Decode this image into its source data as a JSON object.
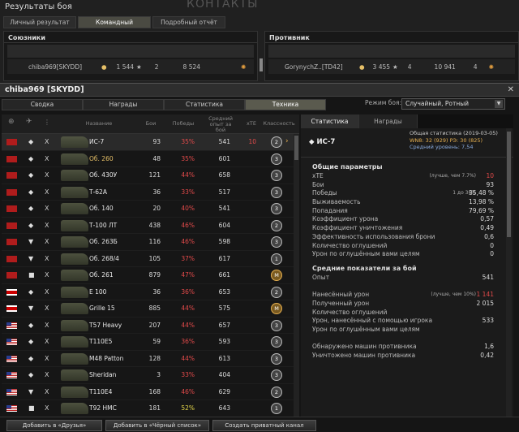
{
  "bg": {
    "faint": "КОНТАКТЫ",
    "title": "Результаты боя",
    "tabs": [
      "Личный результат",
      "Командный результат",
      "Подробный отчёт"
    ]
  },
  "allies": {
    "title": "Союзники",
    "player": "chiba969[SKYDD]",
    "v1": "1 544",
    "v2": "2",
    "v3": "8 524"
  },
  "enemies": {
    "title": "Противник",
    "player": "GorynychZ..[TD42]",
    "v1": "3 455",
    "v2": "4",
    "v3": "10 941",
    "v4": "4"
  },
  "window": {
    "title": "chiba969 [SKYDD]",
    "tabs": [
      "Сводка",
      "Награды",
      "Статистика",
      "Техника"
    ],
    "mode_label": "Режим боя:",
    "mode_value": "Случайный, Ротный"
  },
  "columns": {
    "name": "Название",
    "battles": "Бои",
    "wins": "Победы",
    "exp": "Средний опыт за бой",
    "xte": "хТЕ",
    "class": "Классность"
  },
  "vehicles": [
    {
      "name": "ИС-7",
      "flag": "ussr",
      "type": "◆",
      "tier": "X",
      "battles": "93",
      "win": "35%",
      "wc": "red",
      "exp": "541",
      "xte": "10",
      "badge": "2",
      "bt": "",
      "gold": false,
      "sel": true
    },
    {
      "name": "Об. 260",
      "flag": "ussr",
      "type": "◆",
      "tier": "X",
      "battles": "48",
      "win": "35%",
      "wc": "red",
      "exp": "601",
      "xte": "",
      "badge": "3",
      "bt": "",
      "gold": true,
      "sel": false
    },
    {
      "name": "Об. 430У",
      "flag": "ussr",
      "type": "◆",
      "tier": "X",
      "battles": "121",
      "win": "44%",
      "wc": "red",
      "exp": "658",
      "xte": "",
      "badge": "3",
      "bt": "",
      "gold": false,
      "sel": false
    },
    {
      "name": "Т-62А",
      "flag": "ussr",
      "type": "◆",
      "tier": "X",
      "battles": "36",
      "win": "33%",
      "wc": "red",
      "exp": "517",
      "xte": "",
      "badge": "3",
      "bt": "",
      "gold": false,
      "sel": false
    },
    {
      "name": "Об. 140",
      "flag": "ussr",
      "type": "◆",
      "tier": "X",
      "battles": "20",
      "win": "40%",
      "wc": "red",
      "exp": "541",
      "xte": "",
      "badge": "3",
      "bt": "",
      "gold": false,
      "sel": false
    },
    {
      "name": "Т-100 ЛТ",
      "flag": "ussr",
      "type": "◆",
      "tier": "X",
      "battles": "438",
      "win": "46%",
      "wc": "red",
      "exp": "604",
      "xte": "",
      "badge": "2",
      "bt": "",
      "gold": false,
      "sel": false
    },
    {
      "name": "Об. 263Б",
      "flag": "ussr",
      "type": "▼",
      "tier": "X",
      "battles": "116",
      "win": "46%",
      "wc": "red",
      "exp": "598",
      "xte": "",
      "badge": "3",
      "bt": "",
      "gold": false,
      "sel": false
    },
    {
      "name": "Об. 268/4",
      "flag": "ussr",
      "type": "▼",
      "tier": "X",
      "battles": "105",
      "win": "37%",
      "wc": "red",
      "exp": "617",
      "xte": "",
      "badge": "1",
      "bt": "",
      "gold": false,
      "sel": false
    },
    {
      "name": "Об. 261",
      "flag": "ussr",
      "type": "■",
      "tier": "X",
      "battles": "879",
      "win": "47%",
      "wc": "red",
      "exp": "661",
      "xte": "",
      "badge": "M",
      "bt": "m",
      "gold": false,
      "sel": false
    },
    {
      "name": "E 100",
      "flag": "ger",
      "type": "◆",
      "tier": "X",
      "battles": "36",
      "win": "36%",
      "wc": "red",
      "exp": "653",
      "xte": "",
      "badge": "2",
      "bt": "",
      "gold": false,
      "sel": false
    },
    {
      "name": "Grille 15",
      "flag": "ger",
      "type": "▼",
      "tier": "X",
      "battles": "885",
      "win": "44%",
      "wc": "red",
      "exp": "575",
      "xte": "",
      "badge": "M",
      "bt": "m",
      "gold": false,
      "sel": false
    },
    {
      "name": "T57 Heavy",
      "flag": "usa",
      "type": "◆",
      "tier": "X",
      "battles": "207",
      "win": "44%",
      "wc": "red",
      "exp": "657",
      "xte": "",
      "badge": "3",
      "bt": "",
      "gold": false,
      "sel": false
    },
    {
      "name": "T110E5",
      "flag": "usa",
      "type": "◆",
      "tier": "X",
      "battles": "59",
      "win": "36%",
      "wc": "red",
      "exp": "593",
      "xte": "",
      "badge": "3",
      "bt": "",
      "gold": false,
      "sel": false
    },
    {
      "name": "M48 Patton",
      "flag": "usa",
      "type": "◆",
      "tier": "X",
      "battles": "128",
      "win": "44%",
      "wc": "red",
      "exp": "613",
      "xte": "",
      "badge": "3",
      "bt": "",
      "gold": false,
      "sel": false
    },
    {
      "name": "Sheridan",
      "flag": "usa",
      "type": "◆",
      "tier": "X",
      "battles": "3",
      "win": "33%",
      "wc": "red",
      "exp": "404",
      "xte": "",
      "badge": "3",
      "bt": "",
      "gold": false,
      "sel": false
    },
    {
      "name": "T110E4",
      "flag": "usa",
      "type": "▼",
      "tier": "X",
      "battles": "168",
      "win": "46%",
      "wc": "red",
      "exp": "629",
      "xte": "",
      "badge": "2",
      "bt": "",
      "gold": false,
      "sel": false
    },
    {
      "name": "T92 HMC",
      "flag": "usa",
      "type": "■",
      "tier": "X",
      "battles": "181",
      "win": "52%",
      "wc": "yel",
      "exp": "643",
      "xte": "",
      "badge": "1",
      "bt": "",
      "gold": false,
      "sel": false
    }
  ],
  "right": {
    "tabs": [
      "Статистика",
      "Награды"
    ],
    "vname": "ИС-7",
    "general_stat": "Общая статистика (2019-03-05)",
    "wn8": "WN8: 32 (929) РЭ: 30 (825)",
    "avg_level": "Средний уровень: 7,54",
    "sec1": "Общие параметры",
    "rows1": [
      {
        "l": "хТЕ",
        "n": "(лучше, чем 7.7%)",
        "v": "10"
      },
      {
        "l": "Бои",
        "n": "",
        "v": "93"
      },
      {
        "l": "Победы",
        "n": "1 до 36%",
        "v": "35,48 %"
      },
      {
        "l": "Выживаемость",
        "n": "",
        "v": "13,98 %"
      },
      {
        "l": "Попадания",
        "n": "",
        "v": "79,69 %"
      },
      {
        "l": "Коэффициент урона",
        "n": "",
        "v": "0,57"
      },
      {
        "l": "Коэффициент уничтожения",
        "n": "",
        "v": "0,49"
      },
      {
        "l": "Эффективность использования брони",
        "n": "",
        "v": "0,6"
      },
      {
        "l": "Количество оглушений",
        "n": "",
        "v": "0"
      },
      {
        "l": "Урон по оглушённым вами целям",
        "n": "",
        "v": "0"
      }
    ],
    "sec2": "Средние показатели за бой",
    "rows2": [
      {
        "l": "Опыт",
        "n": "",
        "v": "541"
      },
      {
        "l": "",
        "n": "",
        "v": ""
      },
      {
        "l": "Нанесённый урон",
        "n": "(лучше, чем 10%)",
        "v": "1 141"
      },
      {
        "l": "Полученный урон",
        "n": "",
        "v": "2 015"
      },
      {
        "l": "Количество оглушений",
        "n": "",
        "v": ""
      },
      {
        "l": "Урон, нанесённый с помощью игрока",
        "n": "",
        "v": "533"
      },
      {
        "l": "Урон по оглушённым вами целям",
        "n": "",
        "v": ""
      },
      {
        "l": "",
        "n": "",
        "v": ""
      },
      {
        "l": "Обнаружено машин противника",
        "n": "",
        "v": "1,6"
      },
      {
        "l": "Уничтожено машин противника",
        "n": "",
        "v": "0,42"
      }
    ]
  },
  "buttons": [
    "Добавить в «Друзья»",
    "Добавить в «Чёрный список»",
    "Создать приватный канал"
  ]
}
